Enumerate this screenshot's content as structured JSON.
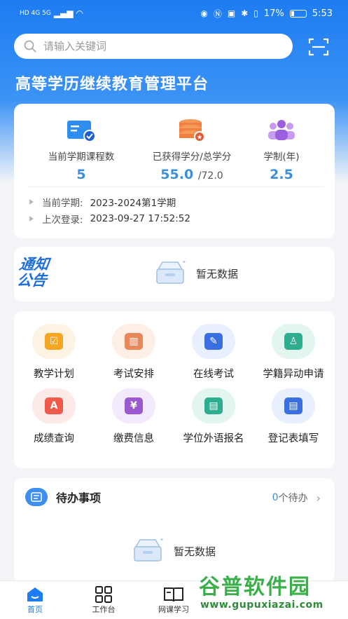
{
  "status_bar": {
    "network": "HD 4G 5G",
    "battery": "17%",
    "time": "5:53"
  },
  "search": {
    "placeholder": "请输入关键词"
  },
  "header": {
    "title": "高等学历继续教育管理平台"
  },
  "stats": {
    "courses": {
      "label": "当前学期课程数",
      "value": "5"
    },
    "credits": {
      "label": "已获得学分/总学分",
      "earned": "55.0",
      "total": "/72.0"
    },
    "years": {
      "label": "学制(年)",
      "value": "2.5"
    }
  },
  "info": {
    "term_key": "当前学期:",
    "term_value": "2023-2024第1学期",
    "login_key": "上次登录:",
    "login_value": "2023-09-27 17:52:52"
  },
  "notice": {
    "logo_line1": "通知",
    "logo_line2": "公告",
    "empty": "暂无数据"
  },
  "grid": [
    {
      "label": "教学计划",
      "icon": "plan-icon",
      "color": "#f5a623"
    },
    {
      "label": "考试安排",
      "icon": "exam-schedule-icon",
      "color": "#e8875a"
    },
    {
      "label": "在线考试",
      "icon": "online-exam-icon",
      "color": "#3a6fe0"
    },
    {
      "label": "学籍异动申请",
      "icon": "status-change-icon",
      "color": "#2fae8f"
    },
    {
      "label": "成绩查询",
      "icon": "score-query-icon",
      "color": "#ef5a4a"
    },
    {
      "label": "缴费信息",
      "icon": "payment-icon",
      "color": "#9b59d0"
    },
    {
      "label": "学位外语报名",
      "icon": "degree-language-icon",
      "color": "#2fae8f"
    },
    {
      "label": "登记表填写",
      "icon": "registration-form-icon",
      "color": "#3a6fe0"
    }
  ],
  "todo": {
    "title": "待办事项",
    "count": "0",
    "count_suffix": "个待办",
    "empty": "暂无数据"
  },
  "tabs": [
    {
      "label": "首页",
      "icon": "home-icon"
    },
    {
      "label": "工作台",
      "icon": "workbench-icon"
    },
    {
      "label": "网课学习",
      "icon": "course-icon"
    }
  ],
  "watermark": {
    "text": "谷普软件园",
    "url": "www.gupuxiazai.com"
  },
  "colors": {
    "primary": "#1d7cf2",
    "value_blue": "#3b8fd9",
    "background": "#f2f4f8"
  }
}
